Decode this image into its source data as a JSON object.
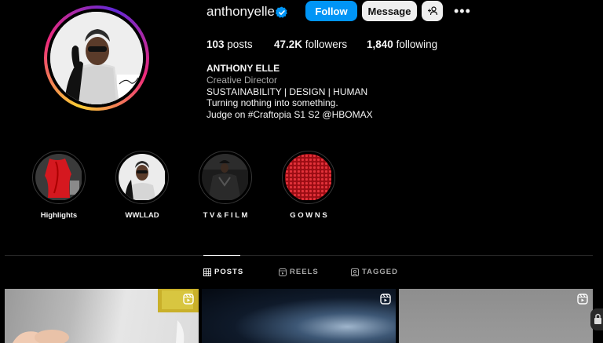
{
  "profile": {
    "username": "anthonyelle",
    "follow_label": "Follow",
    "message_label": "Message",
    "add_user_label": "+",
    "more_label": "•••"
  },
  "stats": {
    "posts_count": "103",
    "posts_label": "posts",
    "followers_count": "47.2K",
    "followers_label": "followers",
    "following_count": "1,840",
    "following_label": "following"
  },
  "bio": {
    "name": "ANTHONY ELLE",
    "category": "Creative Director",
    "lines": [
      "SUSTAINABILITY | DESIGN | HUMAN",
      "Turning nothing into something.",
      "Judge on #Craftopia S1 S2 @HBOMAX"
    ]
  },
  "highlights": [
    {
      "label": "Highlights",
      "icon": "red-dress-image"
    },
    {
      "label": "WWLLAD",
      "icon": "portrait-image"
    },
    {
      "label": "T V & F I L M",
      "icon": "film-still-image"
    },
    {
      "label": "G O W N S",
      "icon": "red-sequin-image"
    }
  ],
  "tabs": [
    {
      "label": "POSTS",
      "icon": "grid-icon",
      "active": true
    },
    {
      "label": "REELS",
      "icon": "reels-icon",
      "active": false
    },
    {
      "label": "TAGGED",
      "icon": "tagged-icon",
      "active": false
    }
  ],
  "colors": {
    "accent": "#0095f6",
    "background": "#000000",
    "text": "#f5f5f5",
    "muted": "#a8a8a8"
  }
}
